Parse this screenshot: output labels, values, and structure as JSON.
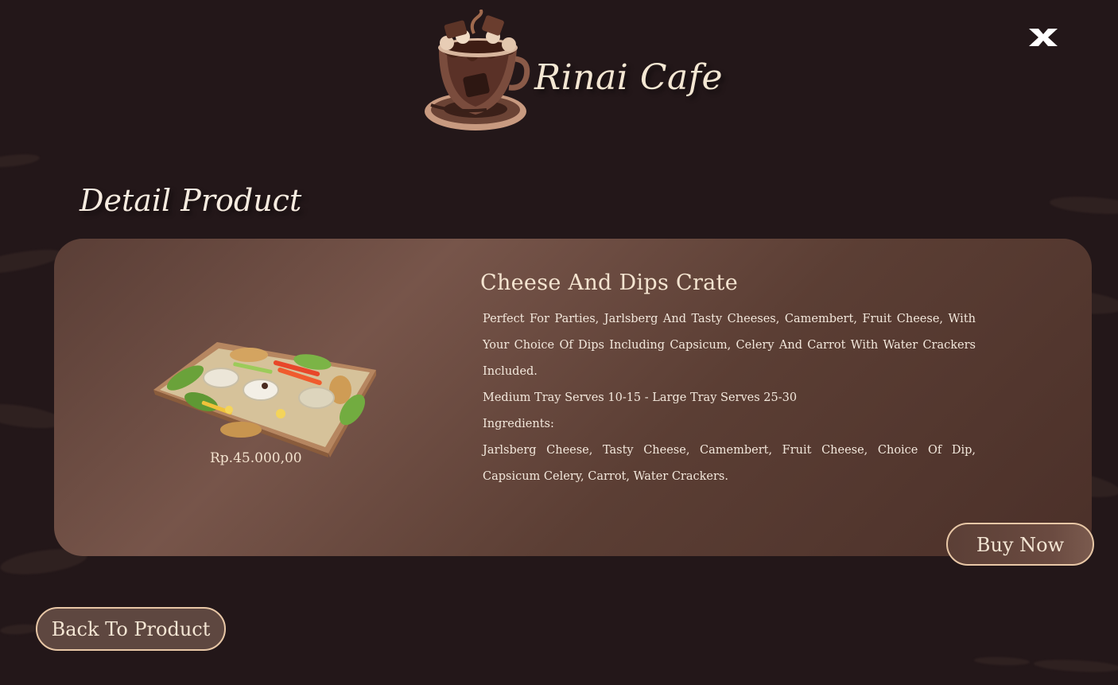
{
  "header": {
    "brand_name": "Rinai Cafe",
    "logo_icon": "coffee-cup-logo",
    "close_icon": "close-icon"
  },
  "page": {
    "section_title": "Detail Product"
  },
  "product": {
    "name": "Cheese And Dips Crate",
    "price": "Rp.45.000,00",
    "description_1": "Perfect For Parties, Jarlsberg And Tasty Cheeses, Camembert, Fruit Cheese, With Your Choice Of Dips Including Capsicum, Celery And Carrot With Water Crackers Included.",
    "serving": "Medium Tray Serves 10-15 - Large Tray Serves 25-30",
    "ingredients_label": "Ingredients:",
    "ingredients": "Jarlsberg Cheese, Tasty Cheese, Camembert, Fruit Cheese, Choice Of Dip, Capsicum Celery, Carrot, Water Crackers."
  },
  "actions": {
    "buy_label": "Buy Now",
    "back_label": "Back To Product"
  },
  "colors": {
    "background": "#231719",
    "card": "#6a4a40",
    "accent_border": "#e8c7a6",
    "text": "#f3e5d3"
  }
}
